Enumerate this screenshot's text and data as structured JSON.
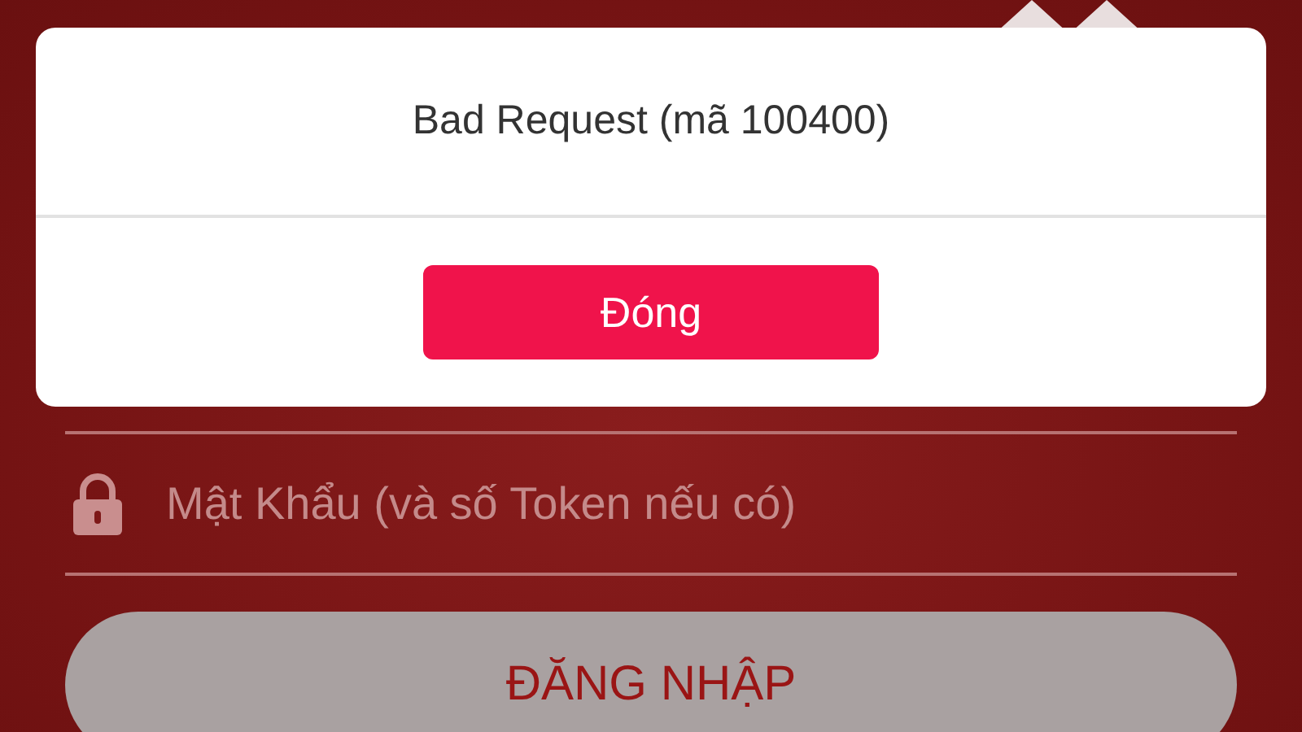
{
  "dialog": {
    "message": "Bad Request (mã 100400)",
    "button": "Đóng"
  },
  "password": {
    "placeholder": "Mật Khẩu (và số Token nếu có)"
  },
  "login_button": "ĐĂNG NHẬP"
}
